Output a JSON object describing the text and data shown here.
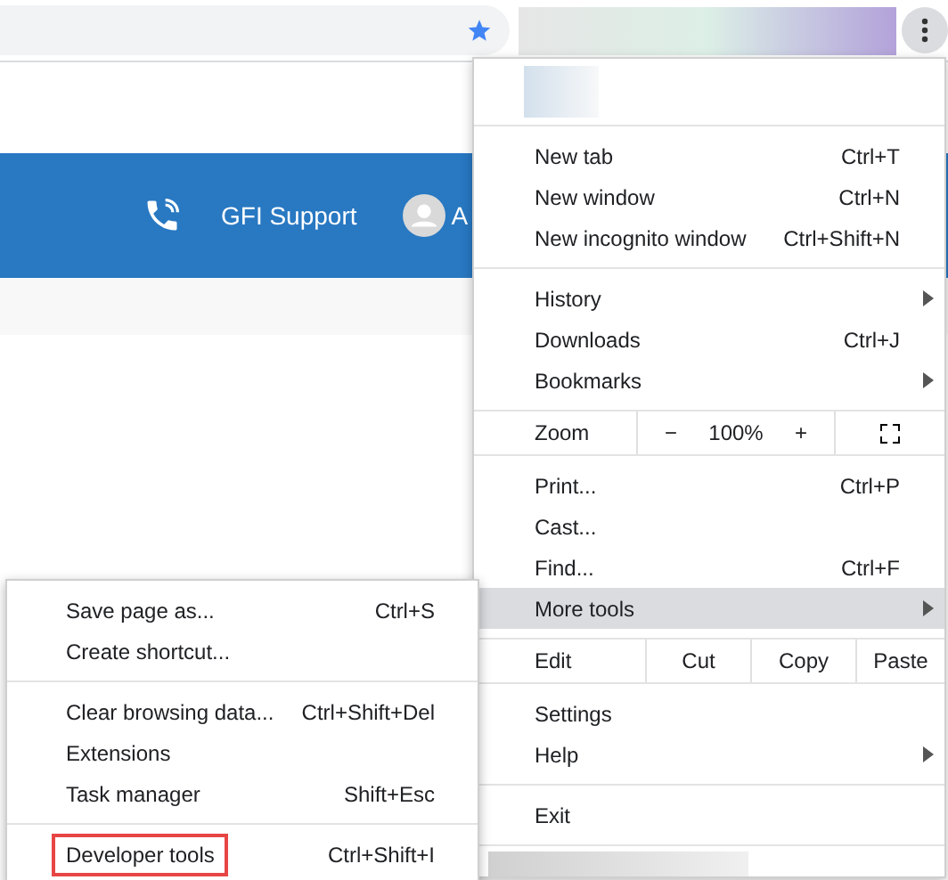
{
  "toolbar": {
    "starred": true
  },
  "page": {
    "header": {
      "support_label": "GFI Support",
      "user_initial": "A"
    }
  },
  "main_menu": {
    "groups": [
      [
        {
          "kind": "profile"
        }
      ],
      [
        {
          "kind": "item",
          "label": "New tab",
          "shortcut": "Ctrl+T",
          "has_submenu": false,
          "selected": false
        },
        {
          "kind": "item",
          "label": "New window",
          "shortcut": "Ctrl+N",
          "has_submenu": false,
          "selected": false
        },
        {
          "kind": "item",
          "label": "New incognito window",
          "shortcut": "Ctrl+Shift+N",
          "has_submenu": false,
          "selected": false
        }
      ],
      [
        {
          "kind": "item",
          "label": "History",
          "has_submenu": true,
          "selected": false
        },
        {
          "kind": "item",
          "label": "Downloads",
          "shortcut": "Ctrl+J",
          "has_submenu": false,
          "selected": false
        },
        {
          "kind": "item",
          "label": "Bookmarks",
          "has_submenu": true,
          "selected": false
        }
      ],
      [
        {
          "kind": "zoom",
          "label": "Zoom",
          "minus": "−",
          "value": "100%",
          "plus": "+"
        }
      ],
      [
        {
          "kind": "item",
          "label": "Print...",
          "shortcut": "Ctrl+P",
          "has_submenu": false,
          "selected": false
        },
        {
          "kind": "item",
          "label": "Cast...",
          "has_submenu": false,
          "selected": false
        },
        {
          "kind": "item",
          "label": "Find...",
          "shortcut": "Ctrl+F",
          "has_submenu": false,
          "selected": false
        },
        {
          "kind": "item",
          "label": "More tools",
          "has_submenu": true,
          "selected": true
        }
      ],
      [
        {
          "kind": "edit",
          "label": "Edit",
          "actions": [
            "Cut",
            "Copy",
            "Paste"
          ]
        }
      ],
      [
        {
          "kind": "item",
          "label": "Settings",
          "has_submenu": false,
          "selected": false
        },
        {
          "kind": "item",
          "label": "Help",
          "has_submenu": true,
          "selected": false
        }
      ],
      [
        {
          "kind": "item",
          "label": "Exit",
          "has_submenu": false,
          "selected": false
        }
      ]
    ]
  },
  "submenu": {
    "groups": [
      [
        {
          "label": "Save page as...",
          "shortcut": "Ctrl+S",
          "highlighted": false
        },
        {
          "label": "Create shortcut...",
          "highlighted": false
        }
      ],
      [
        {
          "label": "Clear browsing data...",
          "shortcut": "Ctrl+Shift+Del",
          "highlighted": false
        },
        {
          "label": "Extensions",
          "highlighted": false
        },
        {
          "label": "Task manager",
          "shortcut": "Shift+Esc",
          "highlighted": false
        }
      ],
      [
        {
          "label": "Developer tools",
          "shortcut": "Ctrl+Shift+I",
          "highlighted": true
        }
      ]
    ]
  }
}
